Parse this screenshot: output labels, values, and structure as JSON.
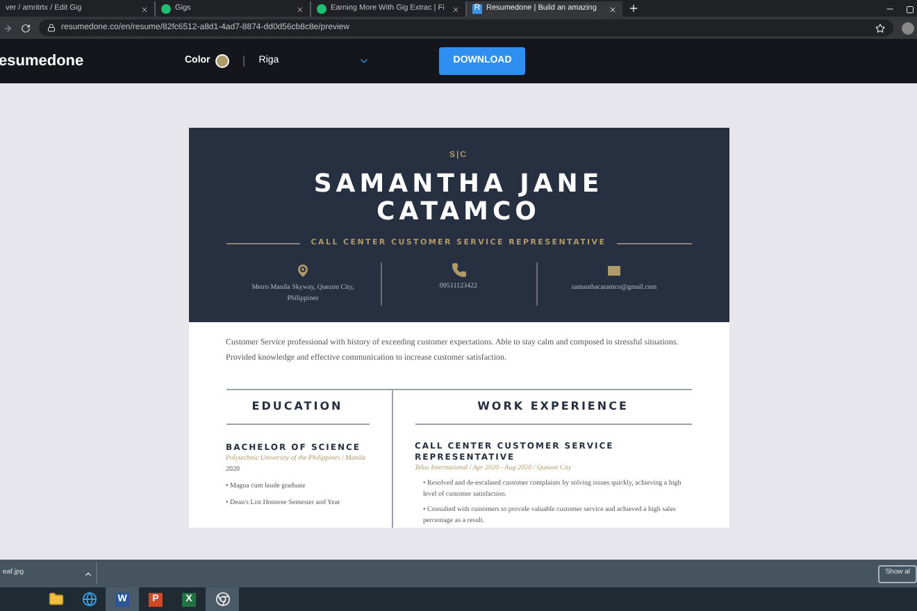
{
  "browser": {
    "tabs": [
      {
        "title": "ver / amritrtx / Edit Gig",
        "selected": false,
        "kind": "plain"
      },
      {
        "title": "Gigs",
        "selected": false,
        "kind": "green"
      },
      {
        "title": "Earning More With Gig Extrac | Fi",
        "selected": false,
        "kind": "green"
      },
      {
        "title": "Resumedone | Build an amazing",
        "selected": true,
        "kind": "blue",
        "letter": "R"
      }
    ],
    "url": "resumedone.co/en/resume/82fc6512-a8d1-4ad7-8874-dd0d56cb8c8e/preview"
  },
  "app_header": {
    "logo": "esumedone",
    "color_label": "Color",
    "color": "#b09a68",
    "template": "Riga",
    "download": "DOWNLOAD"
  },
  "resume": {
    "initials": "S|C",
    "name": "SAMANTHA JANE CATAMCO",
    "title": "CALL CENTER CUSTOMER SERVICE REPRESENTATIVE",
    "contacts": [
      {
        "kind": "location",
        "text": "Metro Manila Skyway, Quezon City, Philippines"
      },
      {
        "kind": "phone",
        "text": "09511123422"
      },
      {
        "kind": "email",
        "text": "samanthacatamco@gmail.com"
      }
    ],
    "summary": "Customer Service professional with history of exceeding customer expectations. Able to stay calm and composed in stressful situations. Provided knowledge and effective communication to increase customer satisfaction.",
    "bullet": "•",
    "education": {
      "heading": "EDUCATION",
      "degree": "BACHELOR OF SCIENCE",
      "school": "Polytechnic University of the Philippines / Manila",
      "year": "2020",
      "bullets": [
        "Magna cum laude graduate",
        "Dean's List Honoree Semester and Year"
      ]
    },
    "work": {
      "heading": "WORK EXPERIENCE",
      "role": "CALL CENTER CUSTOMER SERVICE REPRESENTATIVE",
      "company": "Telus International / Apr 2020 - Aug 2020 / Quezon City",
      "bullets": [
        "Resolved and de-escalated customer complaints by solving issues quickly, achieving a high level of customer satisfaction.",
        "Consulted with customers to provide valuable customer service and achieved a high sales percentage as a result."
      ]
    }
  },
  "download_bar": {
    "file": "eaf.jpg",
    "show_all": "Show al"
  },
  "taskbar": [
    {
      "kind": "folder"
    },
    {
      "kind": "ie"
    },
    {
      "kind": "letter",
      "label": "W",
      "color": "#2b5797",
      "selected": true
    },
    {
      "kind": "letter",
      "label": "P",
      "color": "#d24726",
      "selected": false
    },
    {
      "kind": "letter",
      "label": "X",
      "color": "#217346",
      "selected": false
    },
    {
      "kind": "chrome",
      "selected": true
    }
  ]
}
